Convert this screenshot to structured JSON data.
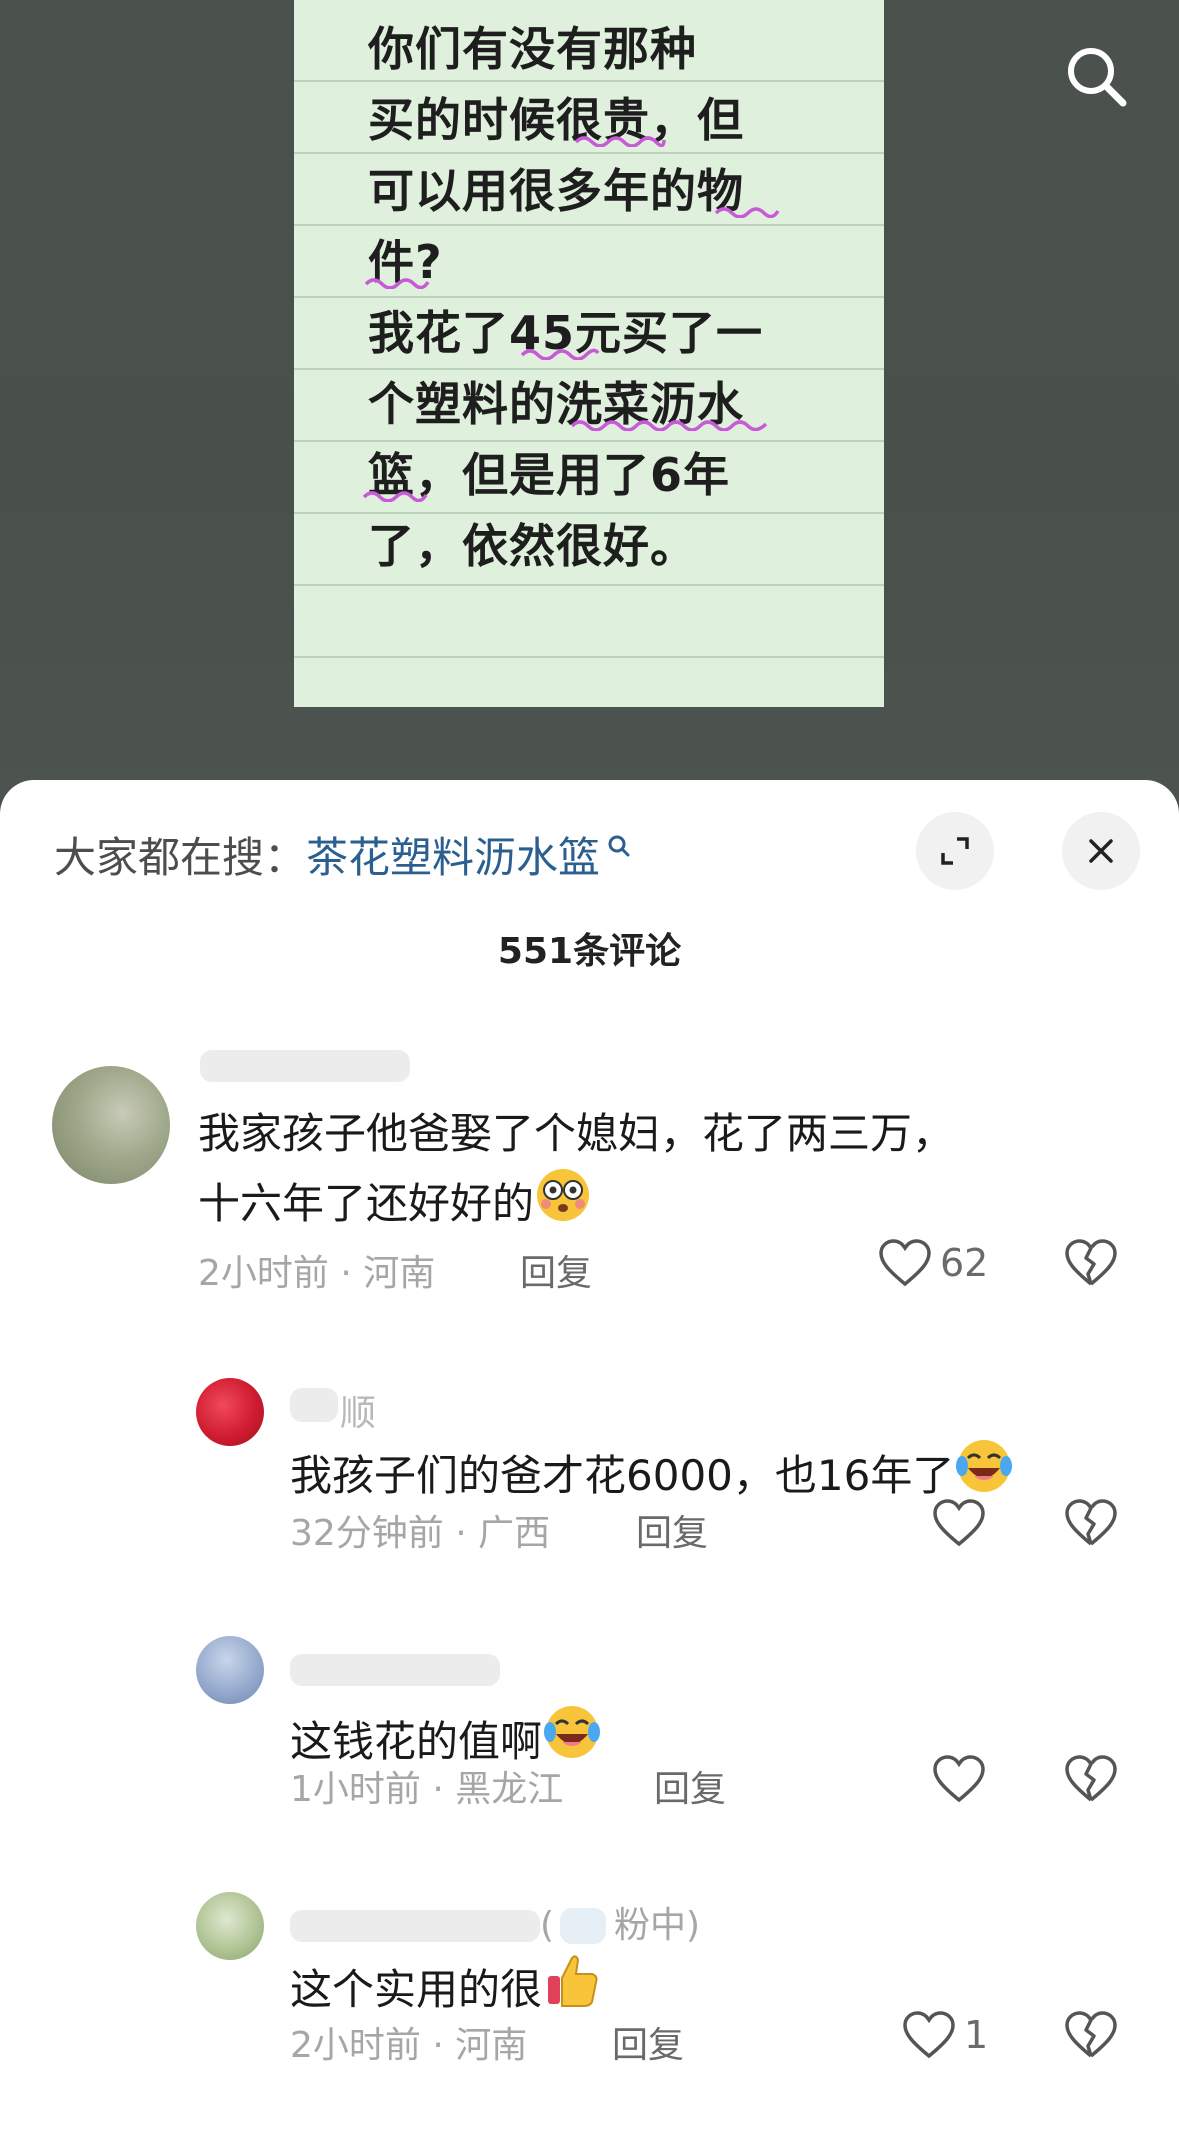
{
  "video": {
    "note_text": "你们有没有那种\n买的时候很贵，但\n可以用很多年的物\n件?\n我花了45元买了一\n个塑料的洗菜沥水\n篮，但是用了6年\n了，依然很好。"
  },
  "sheet": {
    "hot_search_prefix": "大家都在搜：",
    "hot_search_term": "茶花塑料沥水篮",
    "comment_count": "551条评论"
  },
  "comments": [
    {
      "content": "我家孩子他爸娶了个媳妇，花了两三万，\n十六年了还好好的",
      "emoji": "flushed-face",
      "time_location": "2小时前 · 河南",
      "reply": "回复",
      "likes": "62"
    },
    {
      "username": "顺",
      "content": "我孩子们的爸才花6000，也16年了",
      "emoji": "laughing-crying-face",
      "time_location": "32分钟前 · 广西",
      "reply": "回复"
    },
    {
      "content": "这钱花的值啊",
      "emoji": "laughing-crying-face",
      "time_location": "1小时前 · 黑龙江",
      "reply": "回复"
    },
    {
      "username_suffix": "粉中)",
      "content": "这个实用的很",
      "emoji": "thumbs-up",
      "time_location": "2小时前 · 河南",
      "reply": "回复",
      "likes": "1"
    }
  ],
  "colors": {
    "note_bg": "#dff0dc",
    "sheet_bg": "#ffffff",
    "link": "#2b5f8f",
    "squiggle": "#c85ad8"
  }
}
